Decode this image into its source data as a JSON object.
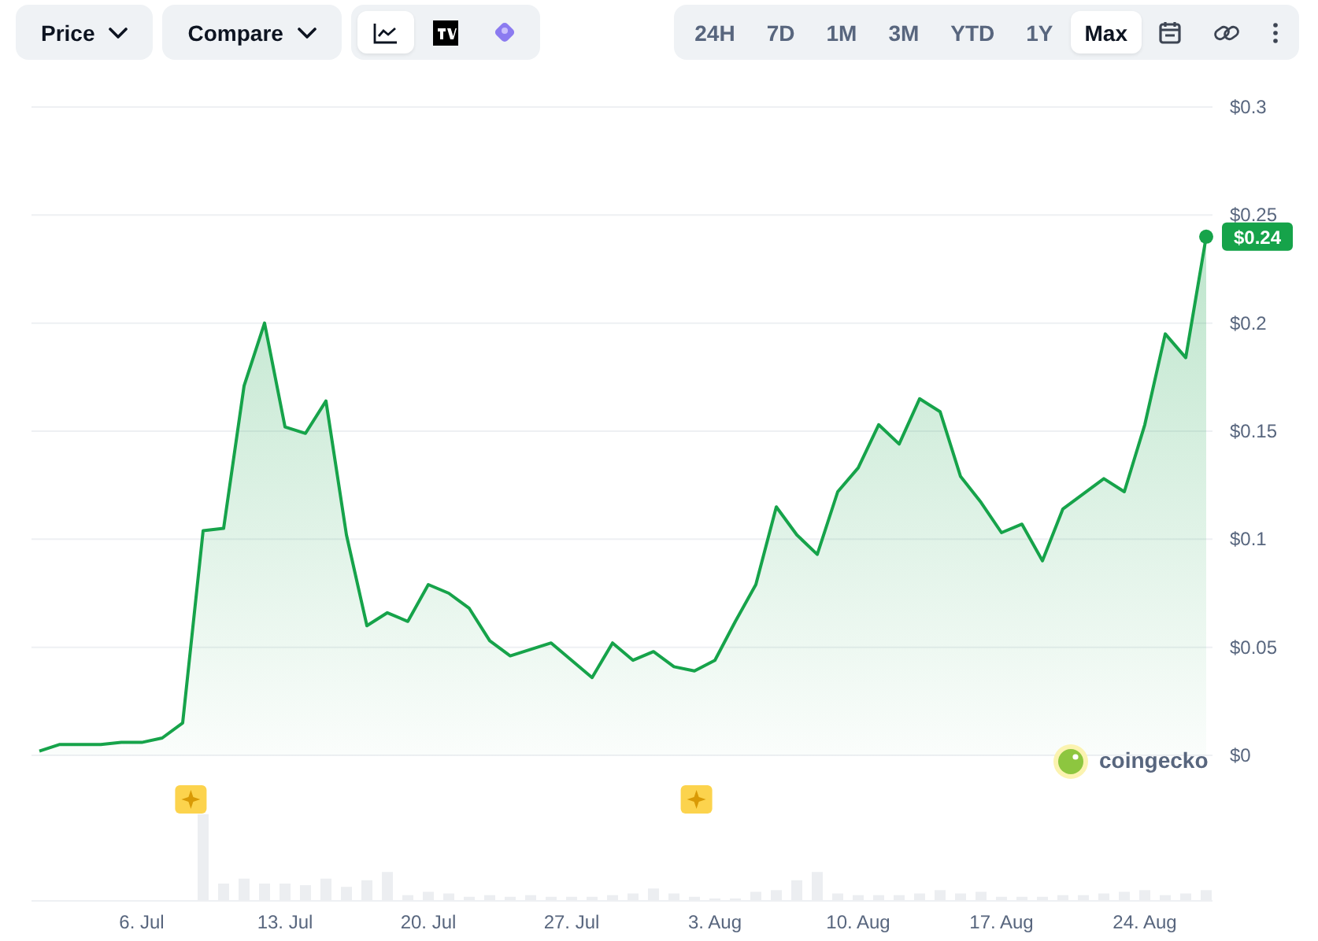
{
  "toolbar": {
    "dropdowns": [
      {
        "label": "Price"
      },
      {
        "label": "Compare"
      }
    ],
    "chart_types": [
      {
        "kind": "line",
        "selected": true
      },
      {
        "kind": "tv",
        "selected": false
      },
      {
        "kind": "gem",
        "selected": false
      }
    ],
    "ranges": [
      {
        "label": "24H",
        "selected": false
      },
      {
        "label": "7D",
        "selected": false
      },
      {
        "label": "1M",
        "selected": false
      },
      {
        "label": "3M",
        "selected": false
      },
      {
        "label": "YTD",
        "selected": false
      },
      {
        "label": "1Y",
        "selected": false
      },
      {
        "label": "Max",
        "selected": true
      }
    ]
  },
  "chart": {
    "brand": "coingecko",
    "last_price_label": "$0.24",
    "chart_data": {
      "type": "area",
      "categories": [
        null,
        null,
        null,
        null,
        null,
        "6. Jul",
        null,
        null,
        null,
        null,
        null,
        null,
        "13. Jul",
        null,
        null,
        null,
        null,
        null,
        null,
        "20. Jul",
        null,
        null,
        null,
        null,
        null,
        null,
        "27. Jul",
        null,
        null,
        null,
        null,
        null,
        null,
        "3. Aug",
        null,
        null,
        null,
        null,
        null,
        null,
        "10. Aug",
        null,
        null,
        null,
        null,
        null,
        null,
        "17. Aug",
        null,
        null,
        null,
        null,
        null,
        null,
        "24. Aug",
        null,
        null,
        null
      ],
      "series": [
        {
          "color": "#16a34a",
          "values": [
            0.002,
            0.005,
            0.005,
            0.005,
            0.006,
            0.006,
            0.008,
            0.015,
            0.104,
            0.105,
            0.171,
            0.2,
            0.152,
            0.149,
            0.164,
            0.102,
            0.06,
            0.066,
            0.062,
            0.079,
            0.075,
            0.068,
            0.053,
            0.046,
            0.049,
            0.052,
            0.044,
            0.036,
            0.052,
            0.044,
            0.048,
            0.041,
            0.039,
            0.044,
            0.062,
            0.079,
            0.115,
            0.102,
            0.093,
            0.122,
            0.133,
            0.153,
            0.144,
            0.165,
            0.159,
            0.129,
            0.117,
            0.103,
            0.107,
            0.09,
            0.114,
            0.121,
            0.128,
            0.122,
            0.153,
            0.195,
            0.184,
            0.24
          ]
        }
      ],
      "ylim": [
        0,
        0.3
      ],
      "grid": true,
      "yticks": [
        {
          "value": 0,
          "label": "$0"
        },
        {
          "value": 0.05,
          "label": "$0.05"
        },
        {
          "value": 0.1,
          "label": "$0.1"
        },
        {
          "value": 0.15,
          "label": "$0.15"
        },
        {
          "value": 0.2,
          "label": "$0.2"
        },
        {
          "value": 0.25,
          "label": "$0.25"
        },
        {
          "value": 0.3,
          "label": "$0.3"
        }
      ]
    }
  }
}
